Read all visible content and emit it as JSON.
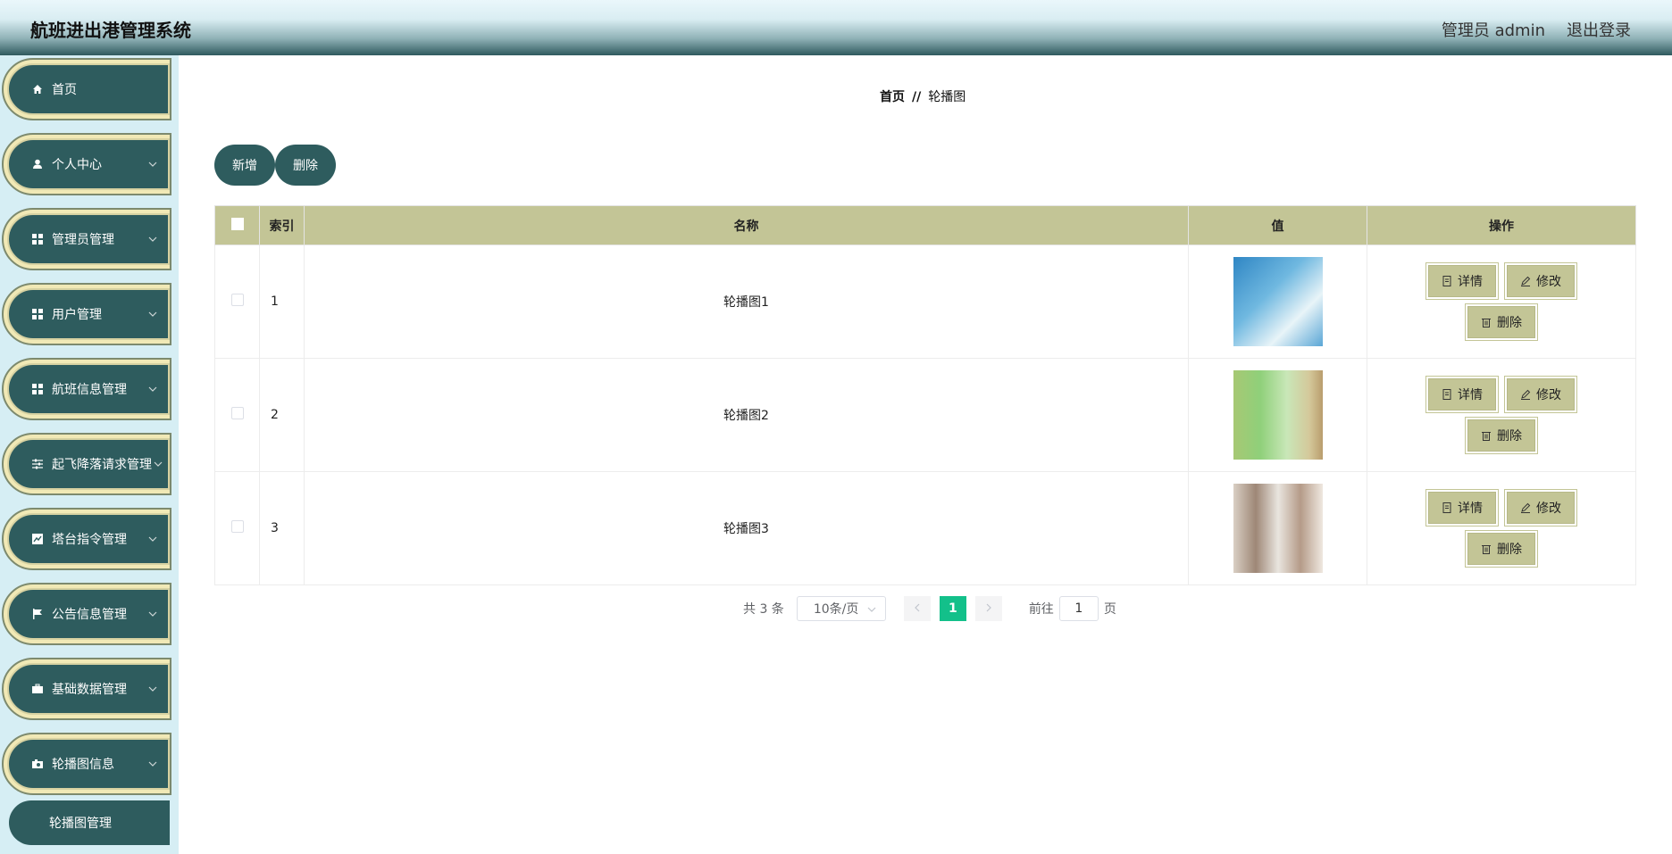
{
  "header": {
    "title": "航班进出港管理系统",
    "user": "管理员 admin",
    "logout": "退出登录"
  },
  "sidebar": {
    "items": [
      {
        "label": "首页",
        "icon": "home-icon"
      },
      {
        "label": "个人中心",
        "icon": "user-icon"
      },
      {
        "label": "管理员管理",
        "icon": "grid-icon"
      },
      {
        "label": "用户管理",
        "icon": "grid-icon"
      },
      {
        "label": "航班信息管理",
        "icon": "grid-icon"
      },
      {
        "label": "起飞降落请求管理",
        "icon": "sliders-icon"
      },
      {
        "label": "塔台指令管理",
        "icon": "chart-icon"
      },
      {
        "label": "公告信息管理",
        "icon": "flag-icon"
      },
      {
        "label": "基础数据管理",
        "icon": "briefcase-icon"
      },
      {
        "label": "轮播图信息",
        "icon": "camera-icon"
      }
    ],
    "subitem": "轮播图管理"
  },
  "breadcrumb": {
    "home": "首页",
    "sep": "//",
    "current": "轮播图"
  },
  "toolbar": {
    "add": "新增",
    "delete": "删除"
  },
  "table": {
    "headers": [
      "索引",
      "名称",
      "值",
      "操作"
    ],
    "rows": [
      {
        "index": "1",
        "name": "轮播图1"
      },
      {
        "index": "2",
        "name": "轮播图2"
      },
      {
        "index": "3",
        "name": "轮播图3"
      }
    ],
    "ops": {
      "detail": "详情",
      "edit": "修改",
      "delete": "删除"
    }
  },
  "pagination": {
    "total": "共 3 条",
    "page_size": "10条/页",
    "current": "1",
    "goto": "前往",
    "goto_value": "1",
    "page_suffix": "页"
  },
  "colors": {
    "sidebar_item": "#2e5c5e",
    "table_header": "#c3c596",
    "active_page": "#13c08a"
  }
}
